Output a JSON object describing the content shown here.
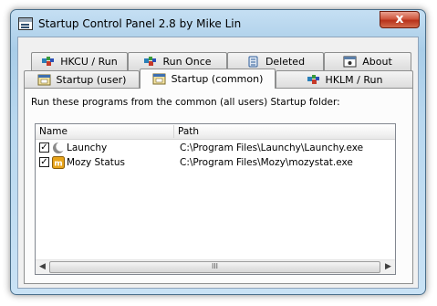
{
  "window": {
    "title": "Startup Control Panel 2.8 by Mike Lin",
    "close_glyph": "x"
  },
  "tabs": {
    "row_back": [
      {
        "label": "HKCU / Run",
        "icon": "registry-icon"
      },
      {
        "label": "Run Once",
        "icon": "registry-icon"
      },
      {
        "label": "Deleted",
        "icon": "recycle-icon"
      },
      {
        "label": "About",
        "icon": "about-icon"
      }
    ],
    "row_front": [
      {
        "label": "Startup (user)",
        "icon": "folder-window-icon"
      },
      {
        "label": "Startup (common)",
        "icon": "folder-window-icon",
        "selected": true
      },
      {
        "label": "HKLM / Run",
        "icon": "registry-icon"
      }
    ]
  },
  "panel": {
    "description": "Run these programs from the common (all users) Startup folder:"
  },
  "list": {
    "columns": [
      "Name",
      "Path"
    ],
    "rows": [
      {
        "checked": true,
        "name": "Launchy",
        "path": "C:\\Program Files\\Launchy\\Launchy.exe",
        "icon": "launchy-icon"
      },
      {
        "checked": true,
        "name": "Mozy Status",
        "path": "C:\\Program Files\\Mozy\\mozystat.exe",
        "icon": "mozy-icon"
      }
    ],
    "check_glyph": "✓",
    "scroll_left": "◀",
    "scroll_right": "▶",
    "thumb_grip": "III"
  }
}
